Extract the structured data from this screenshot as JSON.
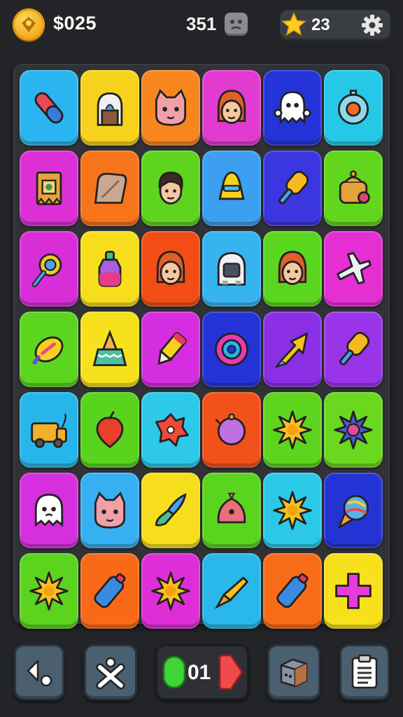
{
  "hud": {
    "money": "$025",
    "score": "351",
    "stars": "23"
  },
  "board": {
    "rows": [
      [
        {
          "icon": "capsule-icon",
          "color": "#2bb5f0"
        },
        {
          "icon": "tree-stump-icon",
          "color": "#f7d21c"
        },
        {
          "icon": "cat-face-icon",
          "color": "#f7861e"
        },
        {
          "icon": "woman-face-icon",
          "color": "#e23bd0"
        },
        {
          "icon": "ghost-icon",
          "color": "#2434d8"
        },
        {
          "icon": "target-icon",
          "color": "#25c8e6"
        }
      ],
      [
        {
          "icon": "scroll-icon",
          "color": "#dd2fd6"
        },
        {
          "icon": "bread-icon",
          "color": "#f8741a"
        },
        {
          "icon": "man-face-icon",
          "color": "#5fd41e"
        },
        {
          "icon": "bell-icon",
          "color": "#3d9ff0"
        },
        {
          "icon": "popsicle-icon",
          "color": "#3a36e0"
        },
        {
          "icon": "pot-icon",
          "color": "#62d61c"
        }
      ],
      [
        {
          "icon": "magnifier-icon",
          "color": "#d82ed8"
        },
        {
          "icon": "potion-icon",
          "color": "#f7de1c"
        },
        {
          "icon": "woman-face-icon",
          "color": "#f24d14"
        },
        {
          "icon": "helmet-icon",
          "color": "#36b4f0"
        },
        {
          "icon": "woman-face-icon",
          "color": "#5ad61e"
        },
        {
          "icon": "airplane-icon",
          "color": "#e52fd2"
        }
      ],
      [
        {
          "icon": "lemon-icon",
          "color": "#5cd51e"
        },
        {
          "icon": "cake-icon",
          "color": "#f7e11c"
        },
        {
          "icon": "crayon-icon",
          "color": "#d52ee0"
        },
        {
          "icon": "ring-icon",
          "color": "#2433d6"
        },
        {
          "icon": "arrow-icon",
          "color": "#8b2fe5"
        },
        {
          "icon": "popsicle-icon",
          "color": "#9a34e8"
        }
      ],
      [
        {
          "icon": "truck-icon",
          "color": "#27b6ec"
        },
        {
          "icon": "leaf-icon",
          "color": "#58d31e"
        },
        {
          "icon": "spiky-ball-icon",
          "color": "#2ec8e8"
        },
        {
          "icon": "planet-icon",
          "color": "#f2521a"
        },
        {
          "icon": "sun-icon",
          "color": "#5ed41e"
        },
        {
          "icon": "virus-icon",
          "color": "#6ad81e"
        }
      ],
      [
        {
          "icon": "ghost-face-icon",
          "color": "#d62fde"
        },
        {
          "icon": "cat-face-icon",
          "color": "#36b0f0"
        },
        {
          "icon": "brush-icon",
          "color": "#f7de1c"
        },
        {
          "icon": "creature-icon",
          "color": "#5ad41e"
        },
        {
          "icon": "sun-icon",
          "color": "#2cc8e8"
        },
        {
          "icon": "ice-cream-icon",
          "color": "#2434d4"
        }
      ],
      [
        {
          "icon": "sun-icon",
          "color": "#5cd31e"
        },
        {
          "icon": "bottle-icon",
          "color": "#f86a18"
        },
        {
          "icon": "sun-icon",
          "color": "#de2ed8"
        },
        {
          "icon": "cone-icon",
          "color": "#2ab8ea"
        },
        {
          "icon": "bottle-icon",
          "color": "#f86c18"
        },
        {
          "icon": "plus-icon",
          "color": "#f7e01c"
        }
      ]
    ]
  },
  "toolbar": {
    "counter": "01"
  }
}
